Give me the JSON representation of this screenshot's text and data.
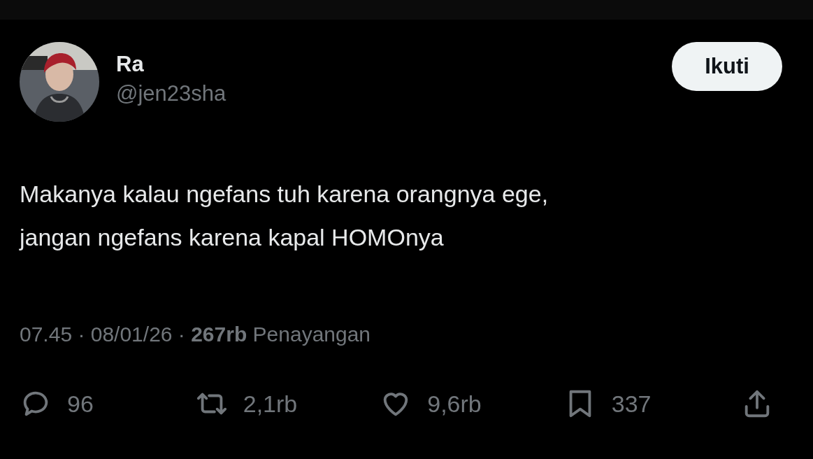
{
  "author": {
    "name": "Ra",
    "handle": "@jen23sha"
  },
  "follow_button": {
    "label": "Ikuti"
  },
  "text_lines": [
    "Makanya kalau ngefans tuh karena orangnya ege,",
    "jangan ngefans karena kapal HOMOnya"
  ],
  "meta": "07.45 · 08/01/26 · **267rb** Penayangan",
  "actions": [
    {
      "kind": "reply",
      "count": "96"
    },
    {
      "kind": "repost",
      "count": "2,1rb"
    },
    {
      "kind": "like",
      "count": "9,6rb"
    },
    {
      "kind": "bookmark",
      "count": "337"
    },
    {
      "kind": "share"
    }
  ]
}
